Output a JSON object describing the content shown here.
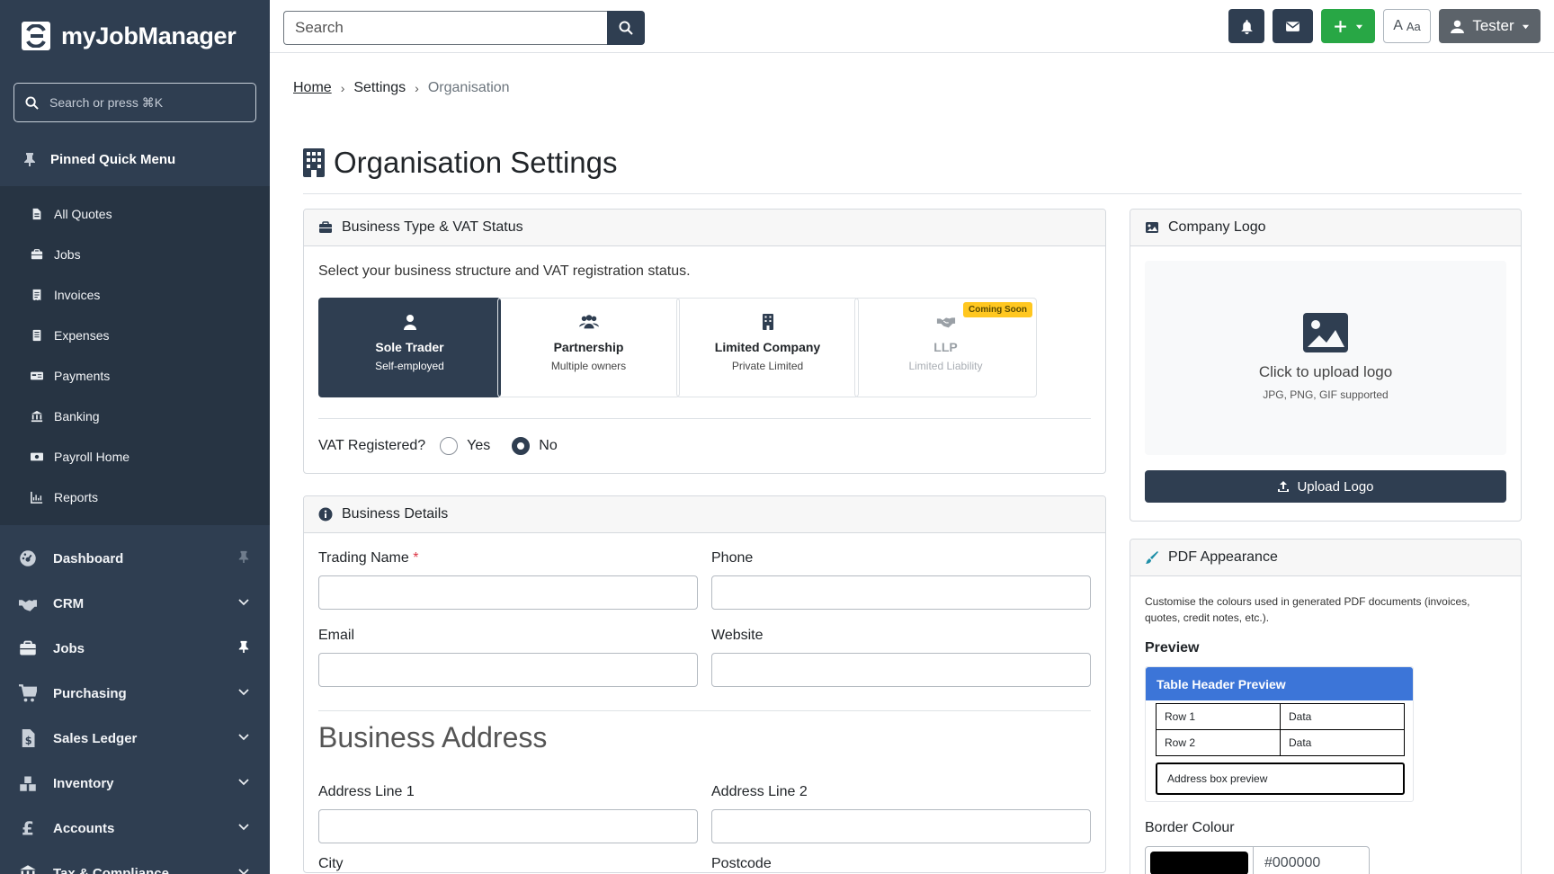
{
  "brand": {
    "name": "myJobManager"
  },
  "sidebar": {
    "search_placeholder": "Search or press ⌘K",
    "pinned_title": "Pinned Quick Menu",
    "pinned_items": [
      {
        "label": "All Quotes",
        "icon": "file-icon"
      },
      {
        "label": "Jobs",
        "icon": "briefcase-icon"
      },
      {
        "label": "Invoices",
        "icon": "invoice-icon"
      },
      {
        "label": "Expenses",
        "icon": "receipt-icon"
      },
      {
        "label": "Payments",
        "icon": "card-icon"
      },
      {
        "label": "Banking",
        "icon": "bank-icon"
      },
      {
        "label": "Payroll Home",
        "icon": "money-icon"
      },
      {
        "label": "Reports",
        "icon": "chart-icon"
      }
    ],
    "nav_items": [
      {
        "label": "Dashboard",
        "icon": "dashboard-icon",
        "right": "pin"
      },
      {
        "label": "CRM",
        "icon": "handshake-icon",
        "right": "chevron"
      },
      {
        "label": "Jobs",
        "icon": "briefcase-icon",
        "right": "pin-active"
      },
      {
        "label": "Purchasing",
        "icon": "cart-icon",
        "right": "chevron"
      },
      {
        "label": "Sales Ledger",
        "icon": "dollar-file-icon",
        "right": "chevron"
      },
      {
        "label": "Inventory",
        "icon": "boxes-icon",
        "right": "chevron"
      },
      {
        "label": "Accounts",
        "icon": "pound-icon",
        "right": "chevron"
      },
      {
        "label": "Tax & Compliance",
        "icon": "bank-icon",
        "right": "chevron"
      }
    ]
  },
  "topbar": {
    "search_placeholder": "Search",
    "font_btn": {
      "a": "A",
      "aa": "Aa"
    },
    "user_name": "Tester",
    "colors": {
      "dark": "#2f3e51",
      "green": "#28a745",
      "grey": "#5c636a"
    }
  },
  "breadcrumb": {
    "home": "Home",
    "settings": "Settings",
    "current": "Organisation"
  },
  "page": {
    "title": "Organisation Settings"
  },
  "business_type": {
    "header": "Business Type & VAT Status",
    "description": "Select your business structure and VAT registration status.",
    "options": [
      {
        "title": "Sole Trader",
        "subtitle": "Self-employed",
        "icon": "user-icon",
        "state": "selected"
      },
      {
        "title": "Partnership",
        "subtitle": "Multiple owners",
        "icon": "users-icon",
        "state": "normal"
      },
      {
        "title": "Limited Company",
        "subtitle": "Private Limited",
        "icon": "building-icon",
        "state": "normal"
      },
      {
        "title": "LLP",
        "subtitle": "Limited Liability",
        "icon": "handshake-icon",
        "state": "disabled",
        "badge": "Coming Soon"
      }
    ],
    "vat_label": "VAT Registered?",
    "vat_yes": "Yes",
    "vat_no": "No",
    "vat_selected": "No"
  },
  "business_details": {
    "header": "Business Details",
    "trading_name": "Trading Name",
    "required_mark": "*",
    "phone": "Phone",
    "email": "Email",
    "website": "Website",
    "address_title": "Business Address",
    "address1": "Address Line 1",
    "address2": "Address Line 2",
    "city": "City",
    "postcode": "Postcode"
  },
  "company_logo": {
    "header": "Company Logo",
    "drop_title": "Click to upload logo",
    "drop_sub": "JPG, PNG, GIF supported",
    "upload_btn": "Upload Logo"
  },
  "pdf_appearance": {
    "header": "PDF Appearance",
    "description": "Customise the colours used in generated PDF documents (invoices, quotes, credit notes, etc.).",
    "preview_label": "Preview",
    "preview_header": "Table Header Preview",
    "preview_rows": [
      [
        "Row 1",
        "Data"
      ],
      [
        "Row 2",
        "Data"
      ]
    ],
    "address_preview": "Address box preview",
    "border_colour_label": "Border Colour",
    "border_colour_value": "#000000",
    "header_colour": "#3c75d8"
  }
}
